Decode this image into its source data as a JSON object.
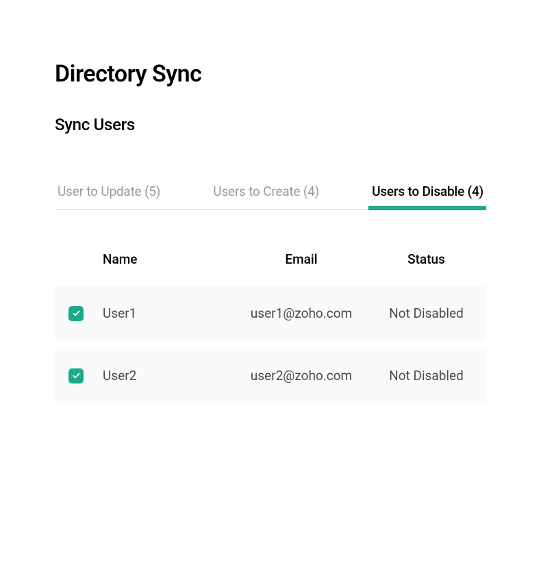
{
  "page_title": "Directory Sync",
  "section_title": "Sync Users",
  "tabs": [
    {
      "label": "User to Update (5)",
      "active": false
    },
    {
      "label": "Users to Create (4)",
      "active": false
    },
    {
      "label": "Users to Disable (4)",
      "active": true
    }
  ],
  "table": {
    "headers": {
      "name": "Name",
      "email": "Email",
      "status": "Status"
    },
    "rows": [
      {
        "name": "User1",
        "email": "user1@zoho.com",
        "status": "Not Disabled",
        "checked": true
      },
      {
        "name": "User2",
        "email": "user2@zoho.com",
        "status": "Not Disabled",
        "checked": true
      }
    ]
  },
  "colors": {
    "accent": "#1aab8b"
  }
}
